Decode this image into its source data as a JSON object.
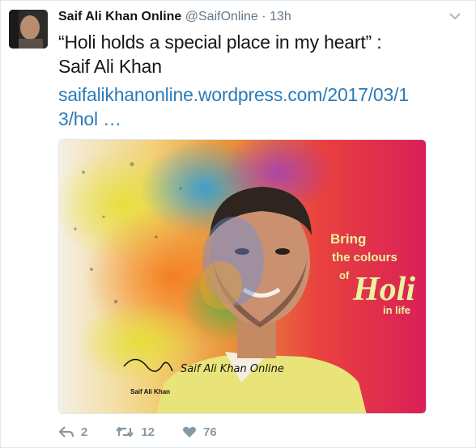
{
  "tweet": {
    "author_name": "Saif Ali Khan Online",
    "handle": "@SaifOnline",
    "separator": "·",
    "time": "13h",
    "text_line1": "“Holi holds a special place in my heart” :",
    "text_line2": "Saif Ali Khan",
    "link_line1": "saifalikhanonline.wordpress.com/2017/03/1",
    "link_line2": "3/hol  …"
  },
  "media": {
    "headline_line1": "Bring",
    "headline_line2": "the colours",
    "headline_of": "of",
    "headline_holi": "Holi",
    "headline_line4": "in life",
    "watermark": "Saif Ali Khan Online",
    "signature_caption": "Saif Ali Khan",
    "brand_color": "#e8f4a0"
  },
  "actions": {
    "reply_count": "2",
    "retweet_count": "12",
    "like_count": "76"
  },
  "icons": {
    "reply": "reply-icon",
    "retweet": "retweet-icon",
    "like": "heart-icon",
    "menu": "chevron-down-icon"
  }
}
